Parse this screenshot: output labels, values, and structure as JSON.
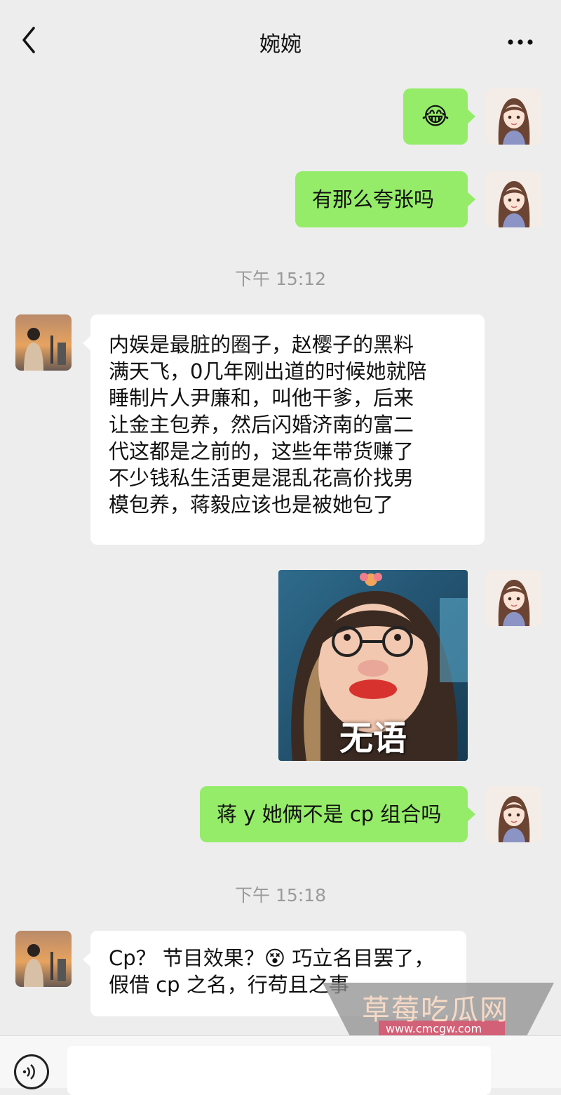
{
  "header": {
    "title": "婉婉"
  },
  "messages": {
    "m1_emoji": "😂",
    "m2": "有那么夸张吗",
    "time1": "下午 15:12",
    "m3_lines": [
      "内娱是最脏的圈子，赵樱子的黑料",
      "满天飞，0几年刚出道的时候她就陪",
      "睡制片人尹廉和，叫他干爹，后来",
      "让金主包养，然后闪婚济南的富二",
      "代这都是之前的，这些年带货赚了",
      "不少钱私生活更是混乱花高价找男",
      "模包养，蒋毅应该也是被她包了"
    ],
    "sticker_caption": "无语",
    "m5": "蒋 y 她俩不是 cp 组合吗",
    "time2": "下午 15:18",
    "m6_line1_a": "Cp？ 节目效果？",
    "m6_emoji": "😵",
    "m6_line1_b": " 巧立名目罢了，",
    "m6_line2": "假借 cp 之名，行苟且之事"
  },
  "watermark": {
    "text": "草莓吃瓜网",
    "url": "www.cmcgw.com"
  },
  "colors": {
    "my_bubble": "#95ec69",
    "their_bubble": "#ffffff",
    "background": "#ededed"
  },
  "icons": {
    "back": "chevron-left-icon",
    "more": "more-dots-icon",
    "voice": "voice-icon"
  }
}
